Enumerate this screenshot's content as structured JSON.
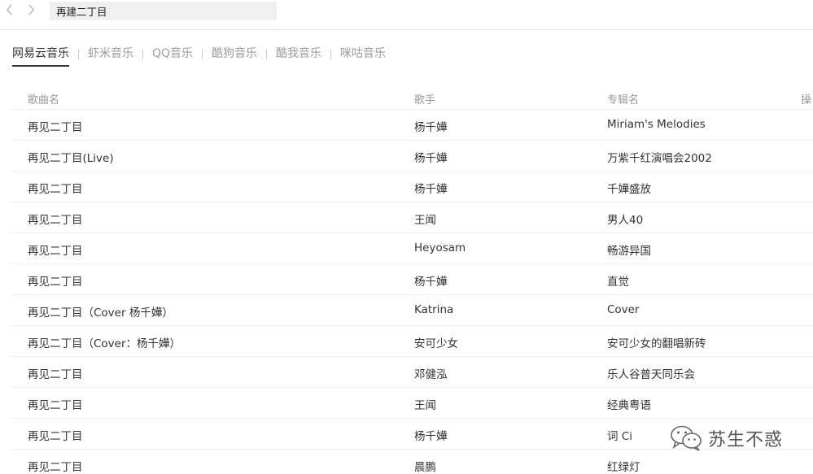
{
  "search": {
    "value": "再建二丁目"
  },
  "tabs": [
    {
      "label": "网易云音乐",
      "active": true
    },
    {
      "label": "虾米音乐"
    },
    {
      "label": "QQ音乐"
    },
    {
      "label": "酷狗音乐"
    },
    {
      "label": "酷我音乐"
    },
    {
      "label": "咪咕音乐"
    }
  ],
  "table": {
    "headers": {
      "song": "歌曲名",
      "artist": "歌手",
      "album": "专辑名",
      "op": "操"
    },
    "rows": [
      {
        "song": "再见二丁目",
        "artist": "杨千嬅",
        "album": "Miriam's Melodies"
      },
      {
        "song": "再见二丁目(Live)",
        "artist": "杨千嬅",
        "album": "万紫千红演唱会2002"
      },
      {
        "song": "再见二丁目",
        "artist": "杨千嬅",
        "album": "千嬅盛放"
      },
      {
        "song": "再见二丁目",
        "artist": "王闻",
        "album": "男人40"
      },
      {
        "song": "再见二丁目",
        "artist": "Heyosam",
        "album": "畅游异国"
      },
      {
        "song": "再见二丁目",
        "artist": "杨千嬅",
        "album": "直觉"
      },
      {
        "song": "再见二丁目（Cover 杨千嬅）",
        "artist": "Katrina",
        "album": "Cover"
      },
      {
        "song": "再见二丁目（Cover：杨千嬅）",
        "artist": "安可少女",
        "album": "安可少女的翻唱新砖"
      },
      {
        "song": "再见二丁目",
        "artist": "邓健泓",
        "album": "乐人谷普天同乐会"
      },
      {
        "song": "再见二丁目",
        "artist": "王闻",
        "album": "经典粤语"
      },
      {
        "song": "再见二丁目",
        "artist": "杨千嬅",
        "album": "词 Ci"
      },
      {
        "song": "再见二丁目",
        "artist": "晨鹏",
        "album": "红绿灯"
      }
    ]
  },
  "watermark": {
    "text": "苏生不惑"
  },
  "icons": {
    "back": "chevron-left-icon",
    "forward": "chevron-right-icon",
    "watermark": "wechat-icon"
  },
  "colors": {
    "active_tab": "#333333",
    "inactive_tab": "#9c9c9c",
    "header_text": "#9a9a9a",
    "row_divider": "#eeeeee"
  }
}
